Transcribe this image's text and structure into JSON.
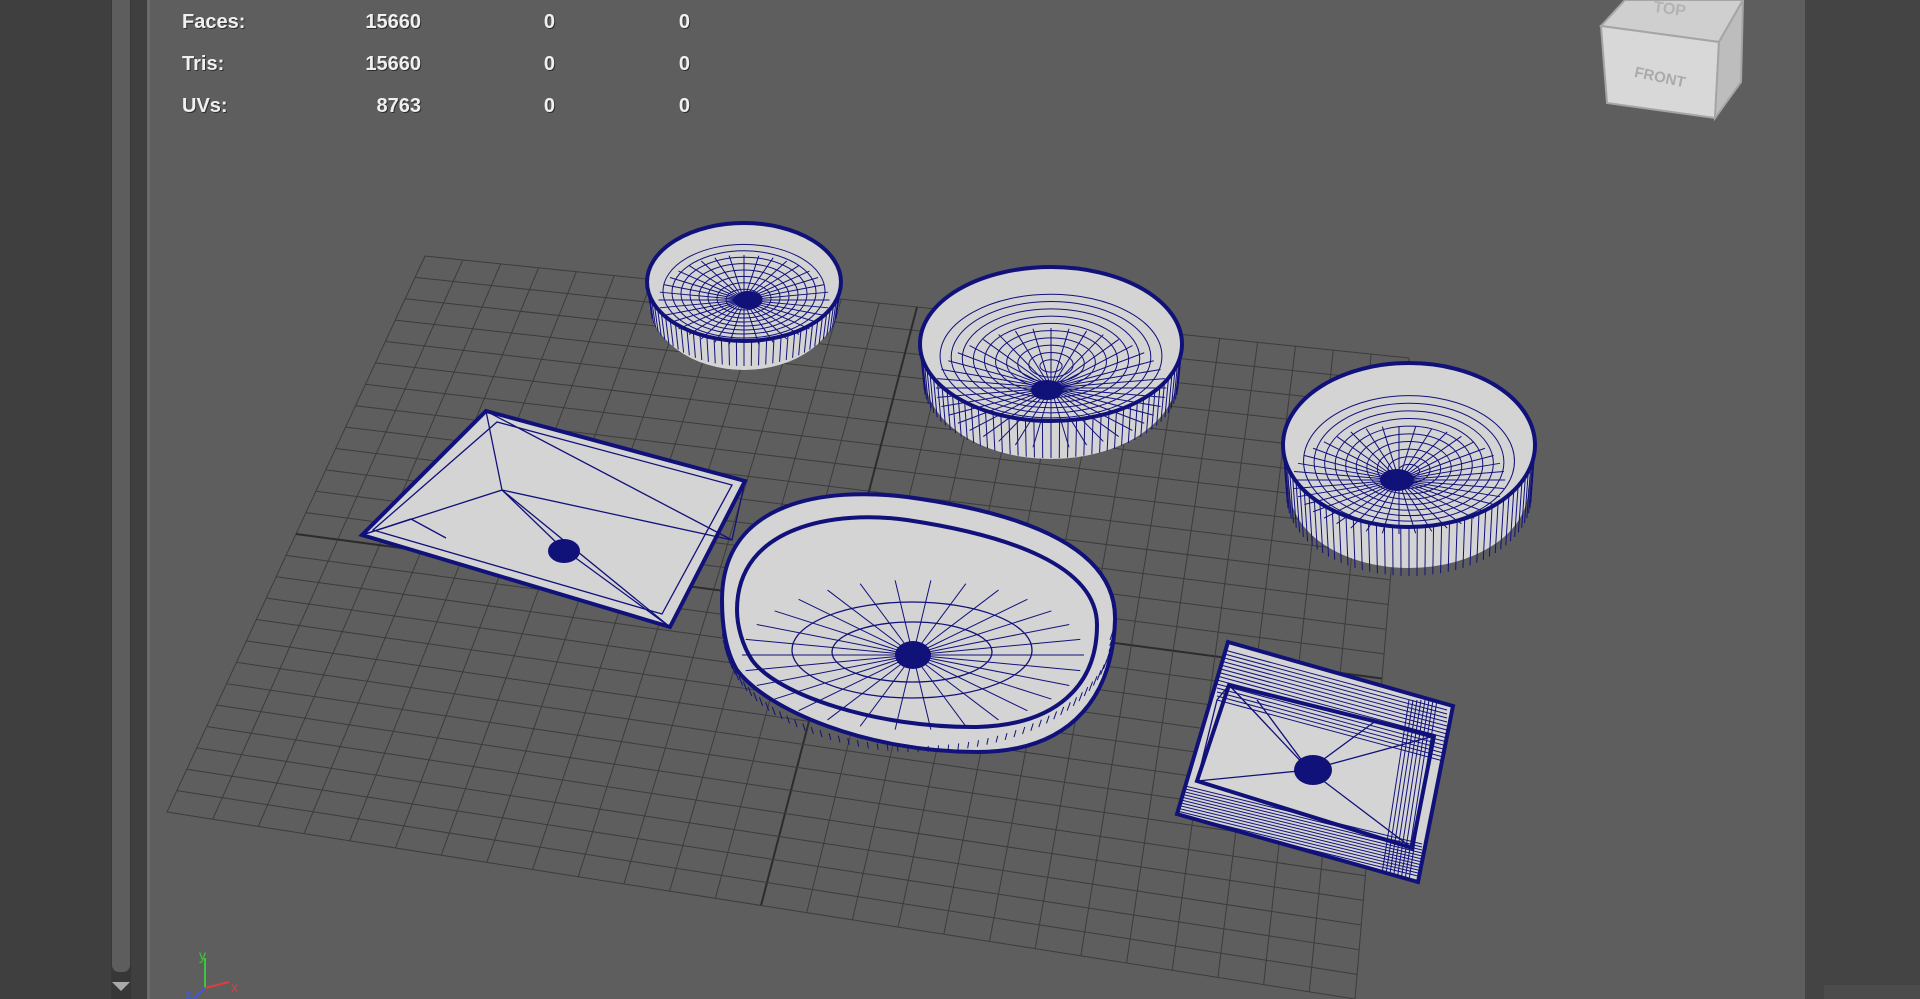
{
  "hud": {
    "rows": [
      {
        "label": "Faces:",
        "values": [
          "15660",
          "0",
          "0"
        ]
      },
      {
        "label": "Tris:",
        "values": [
          "15660",
          "0",
          "0"
        ]
      },
      {
        "label": "UVs:",
        "values": [
          "8763",
          "0",
          "0"
        ]
      }
    ]
  },
  "view_cube": {
    "top_label": "TOP",
    "front_label": "FRONT"
  },
  "axis_indicator": {
    "y": "y",
    "x": "x",
    "z": "z"
  },
  "colors": {
    "viewport_bg": "#5e5e5e",
    "grid": "#3c3c3c",
    "wireframe": "#11117a",
    "mesh_fill": "#d4d4d4"
  },
  "scene": {
    "objects": [
      "round-vessel-sink-small",
      "round-vessel-sink-medium",
      "round-vessel-sink-deep",
      "rectangular-flat-sink",
      "oval-vessel-sink",
      "square-box-sink"
    ]
  }
}
